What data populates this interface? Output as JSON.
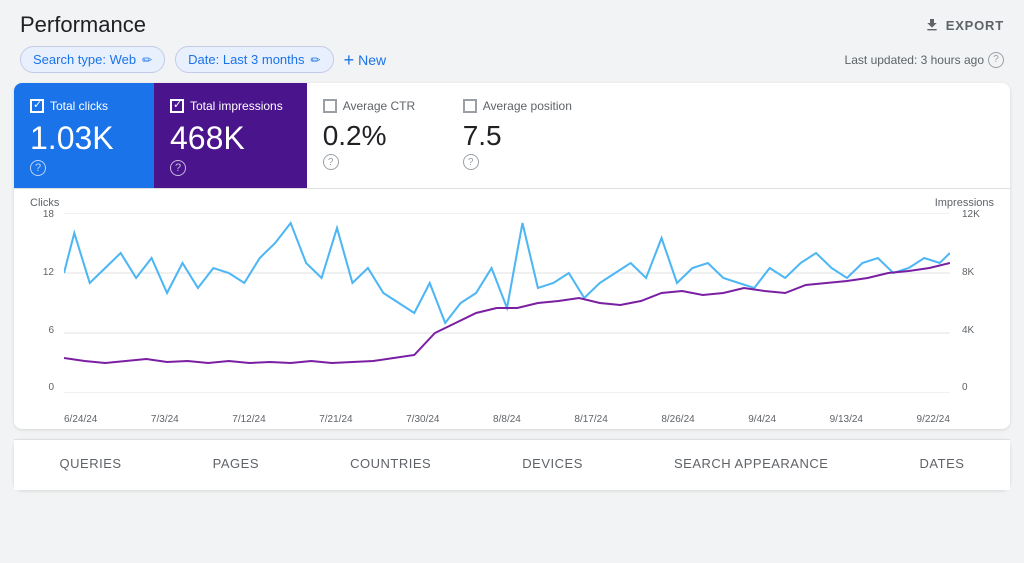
{
  "header": {
    "title": "Performance",
    "export_label": "EXPORT"
  },
  "toolbar": {
    "search_type_label": "Search type: Web",
    "date_label": "Date: Last 3 months",
    "new_label": "New",
    "last_updated": "Last updated: 3 hours ago"
  },
  "metrics": [
    {
      "id": "total-clicks",
      "label": "Total clicks",
      "value": "1.03K",
      "active": true,
      "theme": "clicks"
    },
    {
      "id": "total-impressions",
      "label": "Total impressions",
      "value": "468K",
      "active": true,
      "theme": "impressions"
    },
    {
      "id": "average-ctr",
      "label": "Average CTR",
      "value": "0.2%",
      "active": false,
      "theme": "inactive"
    },
    {
      "id": "average-position",
      "label": "Average position",
      "value": "7.5",
      "active": false,
      "theme": "inactive"
    }
  ],
  "chart": {
    "left_axis_label": "Clicks",
    "right_axis_label": "Impressions",
    "left_axis_values": [
      "18",
      "12",
      "6",
      "0"
    ],
    "right_axis_values": [
      "12K",
      "8K",
      "4K",
      "0"
    ],
    "x_axis_labels": [
      "6/24/24",
      "7/3/24",
      "7/12/24",
      "7/21/24",
      "7/30/24",
      "8/8/24",
      "8/17/24",
      "8/26/24",
      "9/4/24",
      "9/13/24",
      "9/22/24"
    ]
  },
  "tabs": [
    {
      "label": "QUERIES",
      "active": false
    },
    {
      "label": "PAGES",
      "active": false
    },
    {
      "label": "COUNTRIES",
      "active": false
    },
    {
      "label": "DEVICES",
      "active": false
    },
    {
      "label": "SEARCH APPEARANCE",
      "active": false
    },
    {
      "label": "DATES",
      "active": false
    }
  ],
  "colors": {
    "clicks_line": "#4db6f5",
    "impressions_line": "#6a1b9a",
    "clicks_bg": "#1a73e8",
    "impressions_bg": "#4a148c",
    "grid": "#e0e0e0"
  }
}
